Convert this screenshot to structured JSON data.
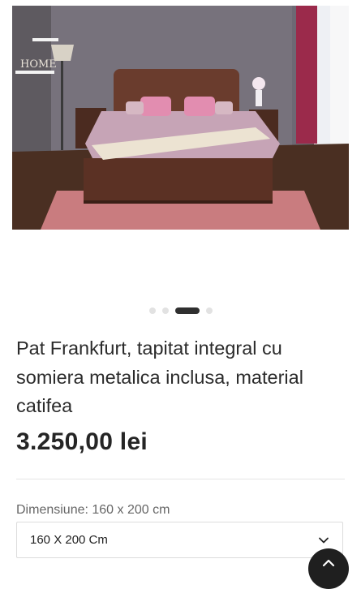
{
  "gallery": {
    "photo_text": "HOME",
    "slide_count": 4,
    "active_slide_index": 2
  },
  "product": {
    "title": "Pat Frankfurt, tapitat integral cu somiera metalica inclusa, material catifea",
    "price": "3.250,00 lei"
  },
  "options": {
    "size_label": "Dimensiune: 160 x 200 cm",
    "size_selected": "160 X 200 Cm"
  },
  "icons": {
    "select": "chevron-down-icon",
    "scroll_top": "chevron-up-icon"
  }
}
